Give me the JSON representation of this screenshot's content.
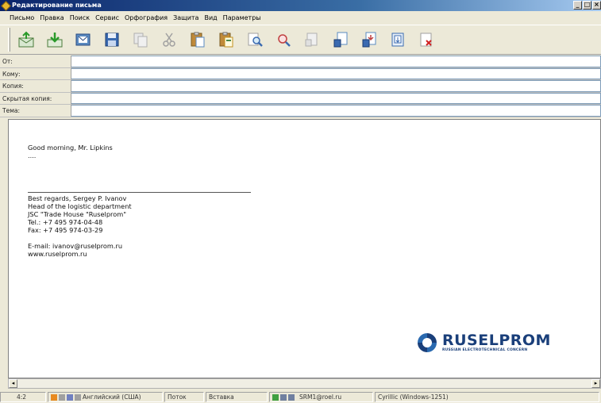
{
  "window": {
    "title": "Редактирование письма",
    "buttons": [
      "_",
      "□",
      "×"
    ]
  },
  "menu": [
    "Письмо",
    "Правка",
    "Поиск",
    "Сервис",
    "Орфография",
    "Защита",
    "Вид",
    "Параметры"
  ],
  "toolbar": {
    "icons": [
      "send-icon",
      "download-icon",
      "mail-icon",
      "save-icon",
      "copy-icon",
      "cut-icon",
      "paste-icon",
      "paste-special-icon",
      "find-icon",
      "find-next-icon",
      "insert-icon",
      "attach-icon",
      "attach-down-icon",
      "template-icon",
      "delete-icon"
    ]
  },
  "headers": {
    "from_label": "От:",
    "from_value": "",
    "to_label": "Кому:",
    "to_value": "",
    "cc_label": "Копия:",
    "cc_value": "",
    "bcc_label": "Скрытая копия:",
    "bcc_value": "",
    "subject_label": "Тема:",
    "subject_value": ""
  },
  "message": {
    "greeting": "Good morning, Mr. Lipkins",
    "ellipsis": "....",
    "signature": {
      "regards": "Best regards, Sergey P. Ivanov",
      "position": "Head of the logistic department",
      "company": "JSC \"Trade House \"Ruselprom\"",
      "tel": "Tel.: +7 495 974-04-48",
      "fax": "Fax: +7 495 974-03-29",
      "email": "E-mail: ivanov@ruselprom.ru",
      "web": "www.ruselprom.ru"
    },
    "logo": {
      "name": "RUSELPROM",
      "tagline": "RUSSIAN ELECTROTECHNICAL CONCERN",
      "color": "#1a3f7a"
    }
  },
  "status": {
    "position": "4:2",
    "language": "Английский (США)",
    "mode": "Поток",
    "insert": "Вставка",
    "account": "SRM1@roel.ru",
    "encoding": "Cyrillic (Windows-1251)"
  }
}
